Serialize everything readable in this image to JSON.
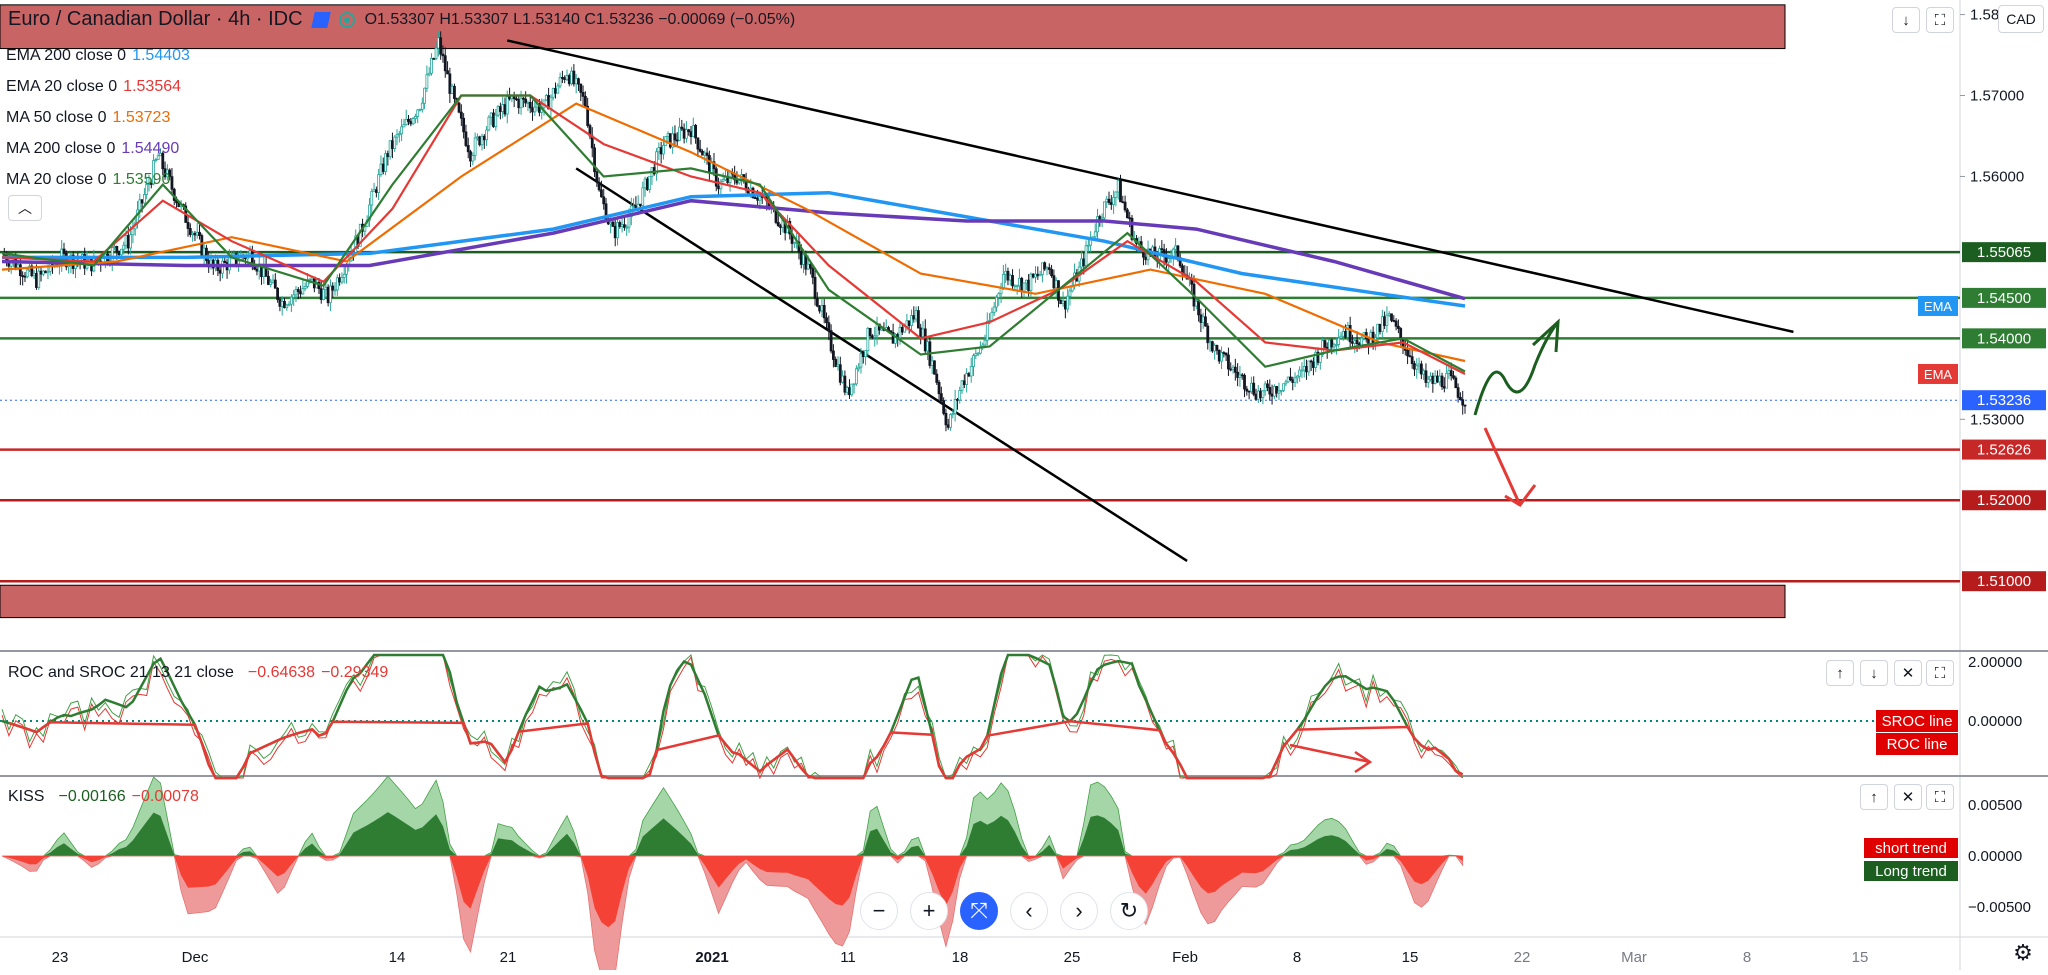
{
  "header": {
    "symbol": "Euro / Canadian Dollar · 4h · IDC",
    "open": "O1.53307",
    "high": "H1.53307",
    "low": "L1.53140",
    "close": "C1.53236",
    "change": "−0.00069 (−0.05%)",
    "currency": "CAD"
  },
  "indicators": [
    {
      "label": "EMA 200 close 0",
      "value": "1.54403",
      "color": "#2196f3"
    },
    {
      "label": "EMA 20 close 0",
      "value": "1.53564",
      "color": "#e53935"
    },
    {
      "label": "MA 50 close 0",
      "value": "1.53723",
      "color": "#ef6c00"
    },
    {
      "label": "MA 200 close 0",
      "value": "1.54490",
      "color": "#673ab7"
    },
    {
      "label": "MA 20 close 0",
      "value": "1.53590",
      "color": "#2e7d32"
    }
  ],
  "roc_pane": {
    "title": "ROC and SROC 21 13 21 close",
    "v1": "−0.64638",
    "v2": "−0.29349",
    "tag_sroc": "SROC line",
    "tag_roc": "ROC line"
  },
  "kiss_pane": {
    "title": "KISS",
    "v1": "−0.00166",
    "v2": "−0.00078",
    "tag_short": "short trend",
    "tag_long": "Long trend"
  },
  "chart_data": {
    "type": "candlestick",
    "title": "Euro / Canadian Dollar · 4h · IDC",
    "x_ticks": [
      "23",
      "Dec",
      "14",
      "21",
      "2021",
      "11",
      "18",
      "25",
      "Feb",
      "8",
      "15",
      "22",
      "Mar",
      "8",
      "15"
    ],
    "y_ticks": [
      "1.58000",
      "1.57000",
      "1.56000",
      "1.55065",
      "1.54500",
      "1.54000",
      "1.53236",
      "1.53000",
      "1.52626",
      "1.52000",
      "1.51000"
    ],
    "ylim": [
      1.5015,
      1.5818
    ],
    "last_price": 1.53236,
    "price_path": [
      [
        0,
        1.5505
      ],
      [
        15,
        1.5472
      ],
      [
        26,
        1.55
      ],
      [
        40,
        1.5492
      ],
      [
        55,
        1.552
      ],
      [
        68,
        1.5625
      ],
      [
        78,
        1.556
      ],
      [
        92,
        1.5485
      ],
      [
        108,
        1.5505
      ],
      [
        122,
        1.5445
      ],
      [
        135,
        1.547
      ],
      [
        142,
        1.545
      ],
      [
        156,
        1.553
      ],
      [
        168,
        1.563
      ],
      [
        182,
        1.569
      ],
      [
        190,
        1.5765
      ],
      [
        197,
        1.569
      ],
      [
        204,
        1.563
      ],
      [
        212,
        1.5665
      ],
      [
        222,
        1.5695
      ],
      [
        236,
        1.5685
      ],
      [
        246,
        1.573
      ],
      [
        254,
        1.569
      ],
      [
        260,
        1.558
      ],
      [
        266,
        1.553
      ],
      [
        276,
        1.556
      ],
      [
        288,
        1.564
      ],
      [
        300,
        1.566
      ],
      [
        312,
        1.559
      ],
      [
        320,
        1.56
      ],
      [
        332,
        1.557
      ],
      [
        342,
        1.5535
      ],
      [
        352,
        1.548
      ],
      [
        360,
        1.54
      ],
      [
        368,
        1.533
      ],
      [
        378,
        1.541
      ],
      [
        388,
        1.54
      ],
      [
        398,
        1.543
      ],
      [
        406,
        1.536
      ],
      [
        412,
        1.529
      ],
      [
        418,
        1.5345
      ],
      [
        428,
        1.54
      ],
      [
        436,
        1.548
      ],
      [
        446,
        1.5465
      ],
      [
        456,
        1.549
      ],
      [
        462,
        1.544
      ],
      [
        470,
        1.549
      ],
      [
        478,
        1.5555
      ],
      [
        486,
        1.5585
      ],
      [
        494,
        1.5515
      ],
      [
        502,
        1.55
      ],
      [
        512,
        1.5505
      ],
      [
        520,
        1.544
      ],
      [
        528,
        1.5385
      ],
      [
        538,
        1.5355
      ],
      [
        548,
        1.533
      ],
      [
        558,
        1.5345
      ],
      [
        566,
        1.5355
      ],
      [
        574,
        1.5385
      ],
      [
        584,
        1.541
      ],
      [
        594,
        1.5395
      ],
      [
        604,
        1.5425
      ],
      [
        612,
        1.5385
      ],
      [
        620,
        1.5345
      ],
      [
        630,
        1.535
      ],
      [
        637,
        1.5324
      ]
    ],
    "moving_averages": [
      {
        "name": "EMA 200 close 0",
        "color": "#2196f3",
        "last": 1.54403,
        "path": [
          [
            0,
            1.55
          ],
          [
            80,
            1.55
          ],
          [
            160,
            1.5505
          ],
          [
            240,
            1.5535
          ],
          [
            300,
            1.5575
          ],
          [
            360,
            1.558
          ],
          [
            420,
            1.555
          ],
          [
            480,
            1.552
          ],
          [
            540,
            1.548
          ],
          [
            600,
            1.5455
          ],
          [
            637,
            1.544
          ]
        ]
      },
      {
        "name": "MA 200 close 0",
        "color": "#673ab7",
        "last": 1.5449,
        "path": [
          [
            0,
            1.5495
          ],
          [
            80,
            1.549
          ],
          [
            160,
            1.549
          ],
          [
            240,
            1.553
          ],
          [
            300,
            1.557
          ],
          [
            360,
            1.5555
          ],
          [
            420,
            1.5545
          ],
          [
            480,
            1.5545
          ],
          [
            520,
            1.5535
          ],
          [
            580,
            1.5495
          ],
          [
            637,
            1.5449
          ]
        ]
      },
      {
        "name": "MA 50 close 0",
        "color": "#ef6c00",
        "last": 1.53723,
        "path": [
          [
            0,
            1.5485
          ],
          [
            50,
            1.5495
          ],
          [
            100,
            1.5525
          ],
          [
            150,
            1.5495
          ],
          [
            200,
            1.56
          ],
          [
            250,
            1.569
          ],
          [
            300,
            1.563
          ],
          [
            350,
            1.556
          ],
          [
            400,
            1.548
          ],
          [
            450,
            1.5455
          ],
          [
            500,
            1.5485
          ],
          [
            550,
            1.5455
          ],
          [
            600,
            1.5395
          ],
          [
            637,
            1.5372
          ]
        ]
      },
      {
        "name": "EMA 20 close 0",
        "color": "#e53935",
        "last": 1.53564,
        "path": [
          [
            0,
            1.55
          ],
          [
            40,
            1.5495
          ],
          [
            70,
            1.557
          ],
          [
            100,
            1.552
          ],
          [
            140,
            1.547
          ],
          [
            170,
            1.556
          ],
          [
            200,
            1.57
          ],
          [
            230,
            1.57
          ],
          [
            262,
            1.564
          ],
          [
            300,
            1.56
          ],
          [
            330,
            1.558
          ],
          [
            360,
            1.549
          ],
          [
            400,
            1.54
          ],
          [
            430,
            1.542
          ],
          [
            460,
            1.546
          ],
          [
            490,
            1.552
          ],
          [
            520,
            1.547
          ],
          [
            550,
            1.5395
          ],
          [
            580,
            1.5385
          ],
          [
            610,
            1.5395
          ],
          [
            637,
            1.5356
          ]
        ]
      },
      {
        "name": "MA 20 close 0",
        "color": "#2e7d32",
        "last": 1.5359,
        "path": [
          [
            0,
            1.5505
          ],
          [
            40,
            1.549
          ],
          [
            70,
            1.559
          ],
          [
            100,
            1.55
          ],
          [
            140,
            1.5465
          ],
          [
            170,
            1.559
          ],
          [
            200,
            1.57
          ],
          [
            230,
            1.57
          ],
          [
            262,
            1.56
          ],
          [
            300,
            1.561
          ],
          [
            330,
            1.559
          ],
          [
            360,
            1.546
          ],
          [
            400,
            1.538
          ],
          [
            430,
            1.539
          ],
          [
            460,
            1.546
          ],
          [
            490,
            1.553
          ],
          [
            520,
            1.545
          ],
          [
            550,
            1.5365
          ],
          [
            580,
            1.5385
          ],
          [
            610,
            1.54
          ],
          [
            637,
            1.5359
          ]
        ]
      }
    ],
    "horizontal_levels": [
      {
        "value": 1.55065,
        "color": "#1b5e20",
        "label": "1.55065"
      },
      {
        "value": 1.545,
        "color": "#2e7d32",
        "label": "1.54500"
      },
      {
        "value": 1.54,
        "color": "#2e7d32",
        "label": "1.54000"
      },
      {
        "value": 1.52626,
        "color": "#c62828",
        "label": "1.52626"
      },
      {
        "value": 1.52,
        "color": "#b71c1c",
        "label": "1.52000"
      },
      {
        "value": 1.51,
        "color": "#b71c1c",
        "label": "1.51000"
      }
    ],
    "zones": [
      {
        "from": 1.5758,
        "to": 1.5812,
        "color": "#b22222"
      },
      {
        "from": 1.5055,
        "to": 1.5095,
        "color": "#b22222"
      }
    ],
    "trendlines": [
      {
        "from": [
          220,
          1.5768
        ],
        "to": [
          780,
          1.5408
        ],
        "color": "#000000"
      },
      {
        "from": [
          250,
          1.561
        ],
        "to": [
          516,
          1.5125
        ],
        "color": "#000000"
      }
    ],
    "roc_ticks": [
      "2.00000",
      "0.00000"
    ],
    "kiss_ticks": [
      "0.00500",
      "0.00000",
      "−0.00500"
    ],
    "axis_tags": [
      {
        "text": "EMA",
        "color": "#2196f3",
        "value": 1.544
      },
      {
        "text": "EMA",
        "color": "#e53935",
        "value": 1.5356
      }
    ]
  },
  "nav": {
    "zoom_out": "−",
    "zoom_in": "+",
    "left": "‹",
    "right": "›"
  }
}
